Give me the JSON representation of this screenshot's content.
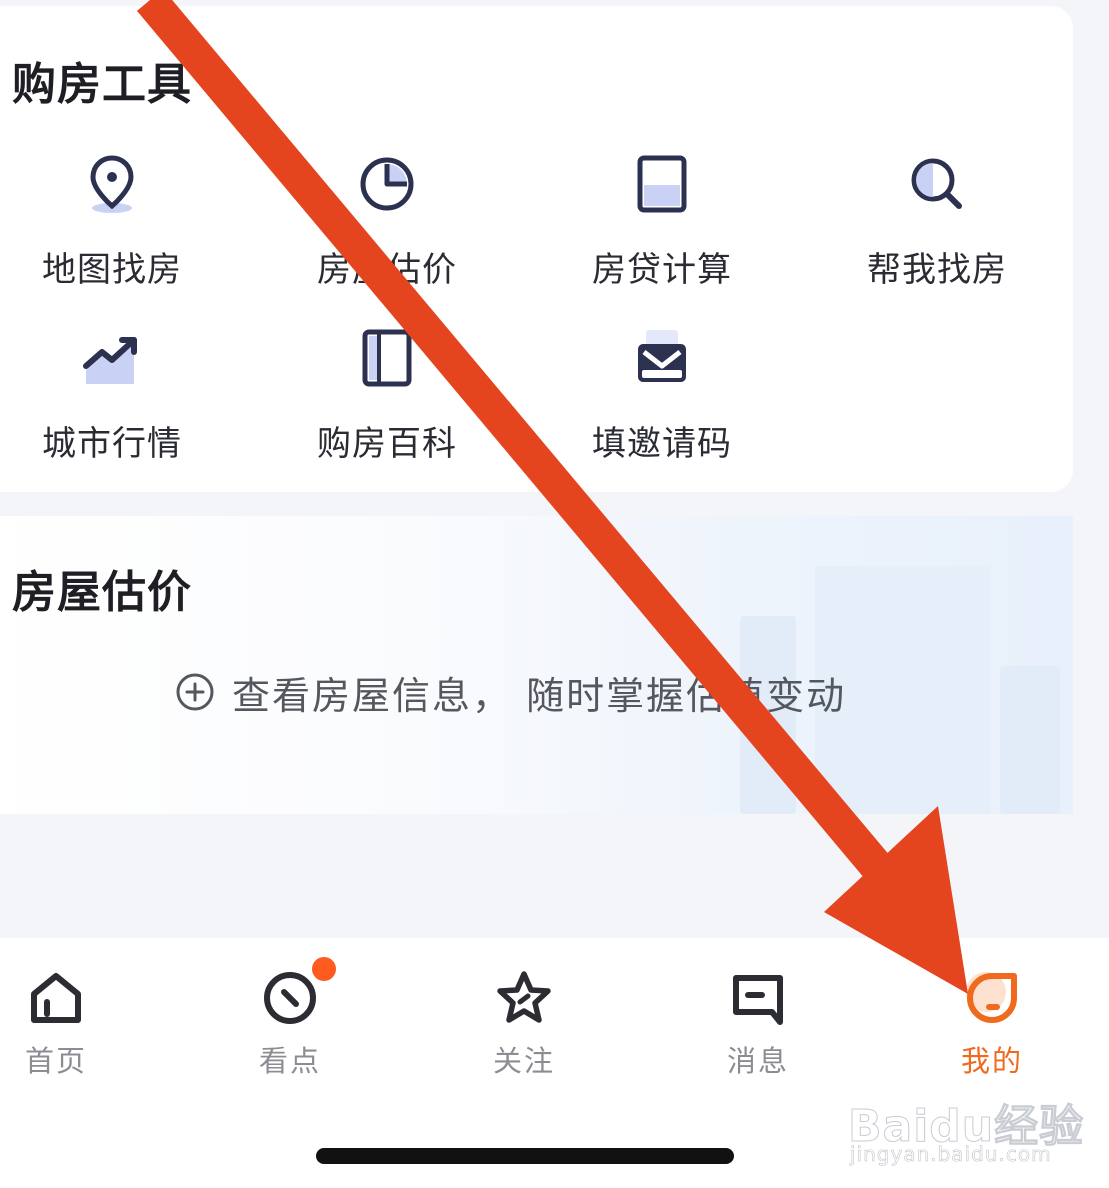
{
  "tools": {
    "title": "购房工具",
    "items": [
      {
        "label": "地图找房",
        "icon": "map-pin-icon"
      },
      {
        "label": "房屋估价",
        "icon": "pie-chart-icon"
      },
      {
        "label": "房贷计算",
        "icon": "calculator-icon"
      },
      {
        "label": "帮我找房",
        "icon": "search-icon"
      },
      {
        "label": "城市行情",
        "icon": "trend-chart-icon"
      },
      {
        "label": "购房百科",
        "icon": "book-icon"
      },
      {
        "label": "填邀请码",
        "icon": "envelope-icon"
      }
    ]
  },
  "estimate": {
    "title": "房屋估价",
    "hint": "查看房屋信息， 随时掌握估值变动",
    "icon": "plus-circle-icon"
  },
  "tabbar": {
    "items": [
      {
        "label": "首页",
        "icon": "home-icon"
      },
      {
        "label": "看点",
        "icon": "compass-icon",
        "badge": true
      },
      {
        "label": "关注",
        "icon": "star-icon"
      },
      {
        "label": "消息",
        "icon": "message-icon"
      },
      {
        "label": "我的",
        "icon": "profile-icon",
        "active": true
      }
    ]
  },
  "watermark": {
    "brand": "Baidu经验",
    "url": "jingyan.baidu.com"
  },
  "colors": {
    "accent": "#f06a1e",
    "badge": "#ff5a1f",
    "icon_dark": "#2d3150",
    "icon_light": "#c9d2f5",
    "arrow": "#e4451f"
  }
}
